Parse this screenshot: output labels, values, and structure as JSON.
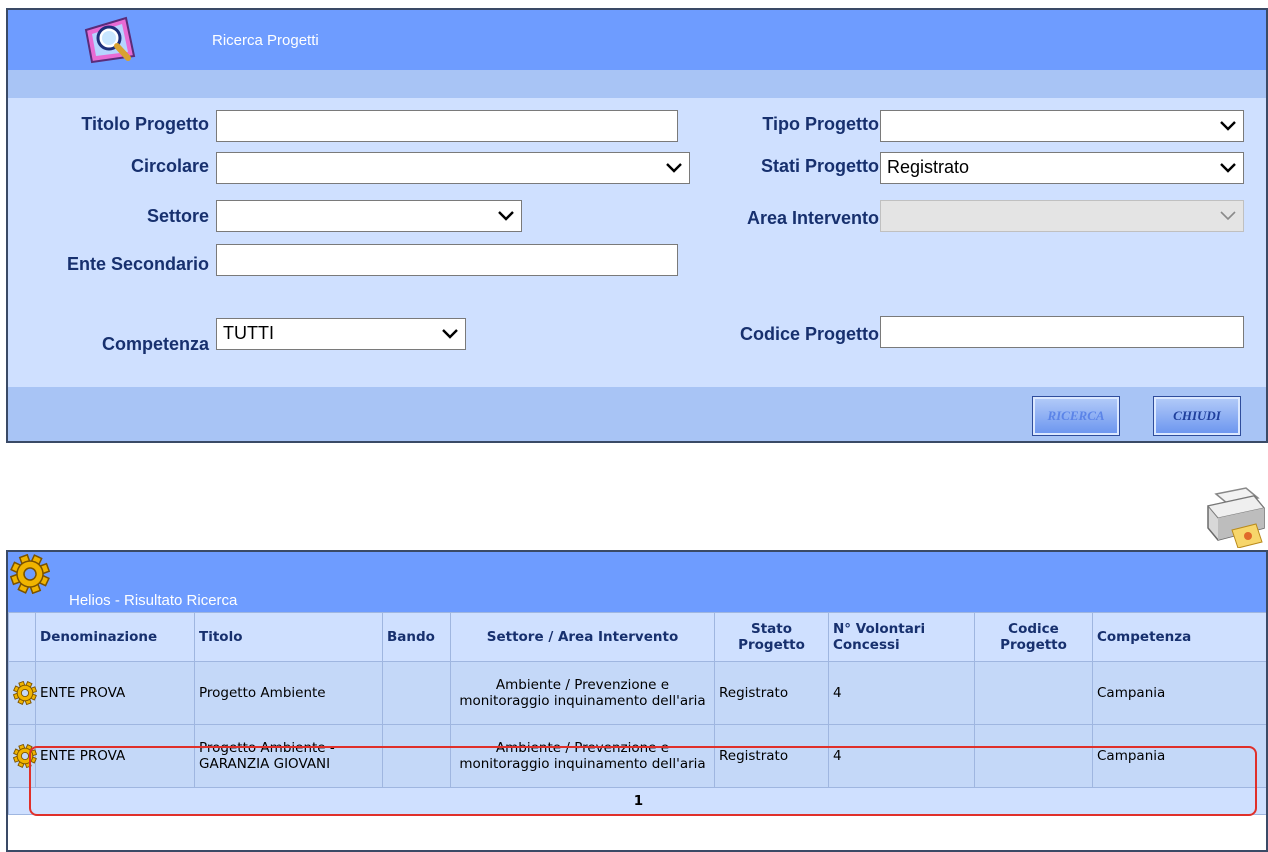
{
  "search": {
    "title": "Ricerca Progetti",
    "fields": {
      "titolo_label": "Titolo Progetto",
      "titolo_value": "",
      "circolare_label": "Circolare",
      "circolare_value": "",
      "settore_label": "Settore",
      "settore_value": "",
      "ente_label": "Ente Secondario",
      "ente_value": "",
      "competenza_label": "Competenza",
      "competenza_value": "TUTTI",
      "tipo_label": "Tipo Progetto",
      "tipo_value": "",
      "stati_label": "Stati Progetto",
      "stati_value": "Registrato",
      "area_label": "Area Intervento",
      "area_value": "",
      "codice_label": "Codice Progetto",
      "codice_value": ""
    },
    "buttons": {
      "ricerca": "RICERCA",
      "chiudi": "CHIUDI"
    }
  },
  "results": {
    "title": "Helios - Risultato Ricerca",
    "columns": [
      "Denominazione",
      "Titolo",
      "Bando",
      "Settore / Area Intervento",
      "Stato Progetto",
      "N° Volontari Concessi",
      "Codice Progetto",
      "Competenza"
    ],
    "rows": [
      {
        "denominazione": "ENTE PROVA",
        "titolo": "Progetto Ambiente",
        "bando": "",
        "settore": "Ambiente / Prevenzione e monitoraggio inquinamento dell'aria",
        "stato": "Registrato",
        "volontari": "4",
        "codice": "",
        "competenza": "Campania"
      },
      {
        "denominazione": "ENTE PROVA",
        "titolo": "Progetto Ambiente - GARANZIA GIOVANI",
        "bando": "",
        "settore": "Ambiente / Prevenzione e monitoraggio inquinamento dell'aria",
        "stato": "Registrato",
        "volontari": "4",
        "codice": "",
        "competenza": "Campania"
      }
    ],
    "pager": {
      "current_page": "1"
    }
  },
  "icons": {
    "search_panel": "magnifier-icon",
    "results_panel": "gear-icon",
    "row_select": "gear-icon",
    "print": "printer-icon",
    "dropdown": "chevron-down-icon"
  },
  "colors": {
    "header_blue": "#6e9cff",
    "panel_bg": "#cfe0ff",
    "label_text": "#17306e",
    "row_bg": "#c4d8f8",
    "highlight_red": "#e0302a"
  }
}
